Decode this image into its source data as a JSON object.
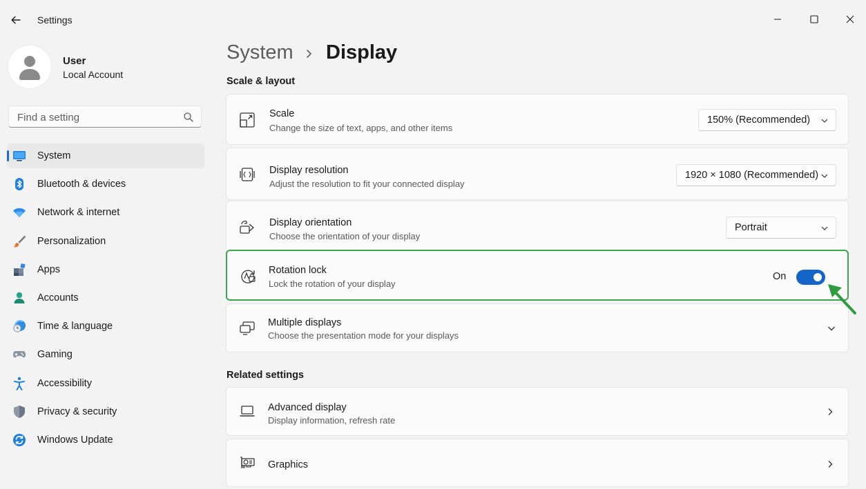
{
  "window": {
    "title": "Settings"
  },
  "user": {
    "name": "User",
    "account": "Local Account"
  },
  "search": {
    "placeholder": "Find a setting",
    "value": ""
  },
  "sidebar": {
    "items": [
      {
        "label": "System",
        "icon": "system-monitor-icon",
        "active": true
      },
      {
        "label": "Bluetooth & devices",
        "icon": "bluetooth-icon"
      },
      {
        "label": "Network & internet",
        "icon": "wifi-icon"
      },
      {
        "label": "Personalization",
        "icon": "brush-icon"
      },
      {
        "label": "Apps",
        "icon": "apps-icon"
      },
      {
        "label": "Accounts",
        "icon": "person-icon"
      },
      {
        "label": "Time & language",
        "icon": "globe-clock-icon"
      },
      {
        "label": "Gaming",
        "icon": "gamepad-icon"
      },
      {
        "label": "Accessibility",
        "icon": "accessibility-icon"
      },
      {
        "label": "Privacy & security",
        "icon": "shield-icon"
      },
      {
        "label": "Windows Update",
        "icon": "update-icon"
      }
    ]
  },
  "breadcrumb": {
    "parent": "System",
    "current": "Display"
  },
  "sections": {
    "scale_layout": "Scale & layout",
    "related": "Related settings"
  },
  "settings": {
    "scale": {
      "title": "Scale",
      "subtitle": "Change the size of text, apps, and other items",
      "value": "150% (Recommended)"
    },
    "resolution": {
      "title": "Display resolution",
      "subtitle": "Adjust the resolution to fit your connected display",
      "value": "1920 × 1080 (Recommended)"
    },
    "orientation": {
      "title": "Display orientation",
      "subtitle": "Choose the orientation of your display",
      "value": "Portrait"
    },
    "rotation_lock": {
      "title": "Rotation lock",
      "subtitle": "Lock the rotation of your display",
      "state_label": "On",
      "enabled": true
    },
    "multiple_displays": {
      "title": "Multiple displays",
      "subtitle": "Choose the presentation mode for your displays"
    }
  },
  "related": {
    "advanced_display": {
      "title": "Advanced display",
      "subtitle": "Display information, refresh rate"
    },
    "graphics": {
      "title": "Graphics"
    }
  },
  "colors": {
    "accent": "#1565c6",
    "highlight": "#3aa54a",
    "annotation_arrow": "#2e9b3e"
  }
}
